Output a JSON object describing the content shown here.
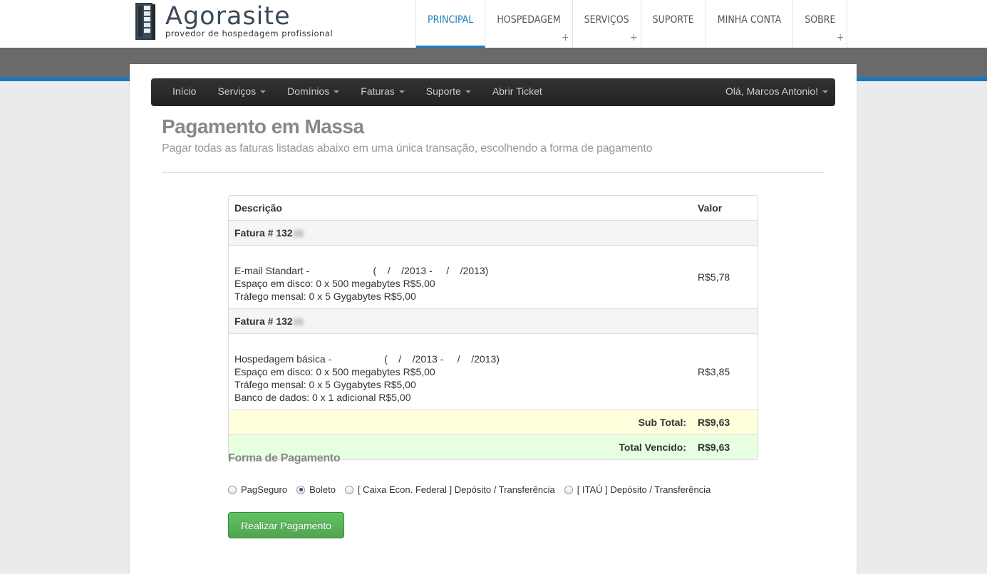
{
  "brand": {
    "name_part1": "Agora",
    "name_part2": "site",
    "tagline": "provedor de hospedagem profissional"
  },
  "main_nav": [
    {
      "label": "PRINCIPAL",
      "active": true,
      "has_submenu": false
    },
    {
      "label": "HOSPEDAGEM",
      "active": false,
      "has_submenu": true
    },
    {
      "label": "SERVIÇOS",
      "active": false,
      "has_submenu": true
    },
    {
      "label": "SUPORTE",
      "active": false,
      "has_submenu": false
    },
    {
      "label": "MINHA CONTA",
      "active": false,
      "has_submenu": false
    },
    {
      "label": "SOBRE",
      "active": false,
      "has_submenu": true
    }
  ],
  "sub_nav": {
    "items": [
      {
        "label": "Início",
        "dropdown": false
      },
      {
        "label": "Serviços",
        "dropdown": true
      },
      {
        "label": "Domínios",
        "dropdown": true
      },
      {
        "label": "Faturas",
        "dropdown": true
      },
      {
        "label": "Suporte",
        "dropdown": true
      },
      {
        "label": "Abrir Ticket",
        "dropdown": false
      }
    ],
    "user_greeting": "Olá, Marcos Antonio!"
  },
  "page": {
    "title": "Pagamento em Massa",
    "subtitle": "Pagar todas as faturas listadas abaixo em uma única transação, escolhendo a forma de pagamento"
  },
  "table": {
    "headers": {
      "description": "Descrição",
      "value": "Valor"
    },
    "invoices": [
      {
        "heading": "Fatura # 132",
        "lines": [
          "E-mail Standart -                       (    /    /2013 -     /    /2013)",
          "Espaço em disco: 0 x 500 megabytes R$5,00",
          "Tráfego mensal: 0 x 5 Gygabytes R$5,00"
        ],
        "value": "R$5,78"
      },
      {
        "heading": "Fatura # 132",
        "lines": [
          "Hospedagem básica -                   (    /    /2013 -     /    /2013)",
          "Espaço em disco: 0 x 500 megabytes R$5,00",
          "Tráfego mensal: 0 x 5 Gygabytes R$5,00",
          "Banco de dados: 0 x 1 adicional R$5,00"
        ],
        "value": "R$3,85"
      }
    ],
    "subtotal_label": "Sub Total:",
    "subtotal_value": "R$9,63",
    "total_label": "Total Vencido:",
    "total_value": "R$9,63"
  },
  "payment": {
    "title": "Forma de Pagamento",
    "methods": [
      {
        "label": "PagSeguro",
        "selected": false
      },
      {
        "label": "Boleto",
        "selected": true
      },
      {
        "label": "[ Caixa Econ. Federal ] Depósito / Transferência",
        "selected": false
      },
      {
        "label": "[ ITAÚ ] Depósito / Transferência",
        "selected": false
      }
    ],
    "submit_label": "Realizar Pagamento"
  },
  "colors": {
    "accent_blue": "#1b78bf",
    "success_green": "#51a351",
    "navbar_dark": "#222222"
  }
}
